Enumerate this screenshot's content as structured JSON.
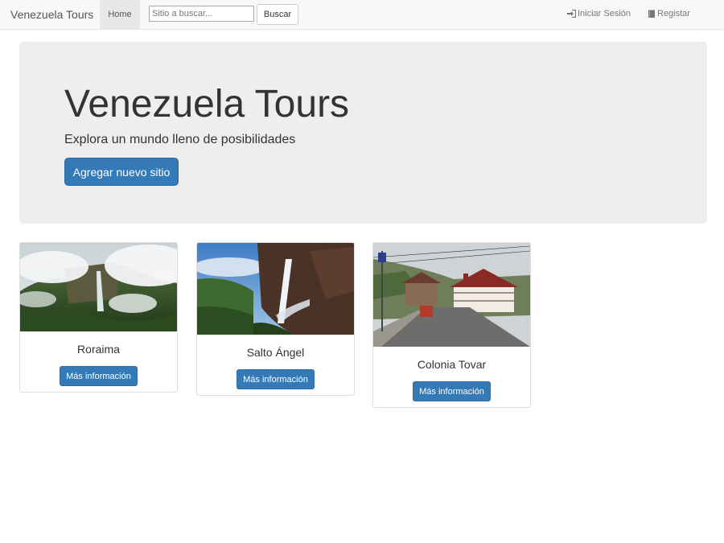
{
  "navbar": {
    "brand": "Venezuela Tours",
    "home": "Home",
    "search_placeholder": "Sitio a buscar...",
    "search_button": "Buscar",
    "login": "Iniciar Sesión",
    "register": "Registar",
    "login_icon": "log-in-icon",
    "register_icon": "book-icon"
  },
  "hero": {
    "title": "Venezuela Tours",
    "subtitle": "Explora un mundo lleno de posibilidades",
    "button": "Agregar nuevo sitio"
  },
  "places": [
    {
      "name": "Roraima",
      "button": "Más información",
      "image": "tepui-landscape-photo"
    },
    {
      "name": "Salto Ángel",
      "button": "Más información",
      "image": "waterfall-photo"
    },
    {
      "name": "Colonia Tovar",
      "button": "Más información",
      "image": "town-street-photo"
    }
  ],
  "colors": {
    "primary": "#337ab7",
    "navbar_bg": "#f8f8f8",
    "hero_bg": "#eeeeee"
  }
}
